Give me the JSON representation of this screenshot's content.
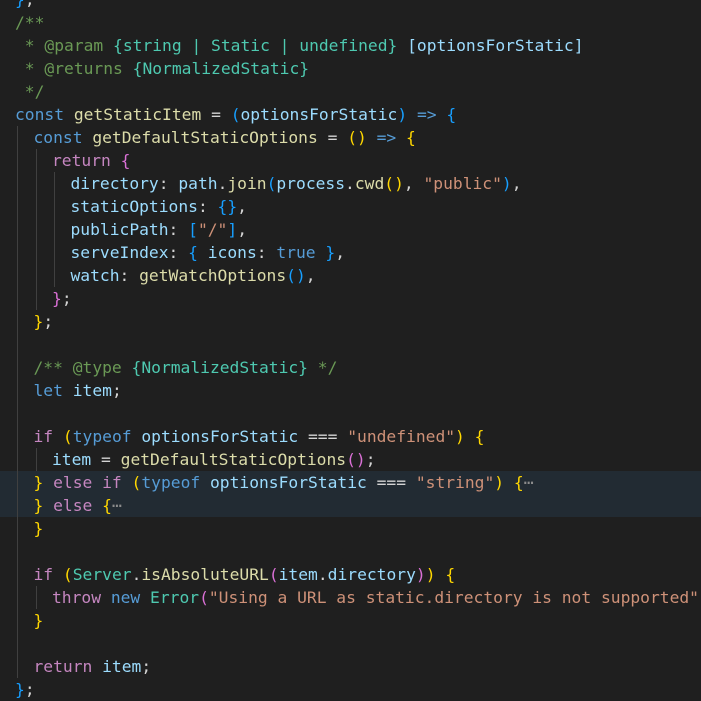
{
  "colors": {
    "background": "#1f1f1f",
    "current_line": "#222b33",
    "indent_guide": "#404040"
  },
  "editor": {
    "language": "javascript",
    "lines": [
      {
        "indent": 1,
        "guides": [],
        "tokens": [
          [
            "b3",
            "}"
          ],
          [
            "pu",
            ";"
          ]
        ]
      },
      {
        "indent": 1,
        "guides": [],
        "tokens": [
          [
            "cm",
            "/**"
          ]
        ]
      },
      {
        "indent": 1,
        "guides": [],
        "tokens": [
          [
            "cm",
            " * @param "
          ],
          [
            "cls",
            "{string | Static | undefined}"
          ],
          [
            "var",
            " [optionsForStatic]"
          ]
        ]
      },
      {
        "indent": 1,
        "guides": [],
        "tokens": [
          [
            "cm",
            " * @returns "
          ],
          [
            "cls",
            "{NormalizedStatic}"
          ]
        ]
      },
      {
        "indent": 1,
        "guides": [],
        "tokens": [
          [
            "cm",
            " */"
          ]
        ]
      },
      {
        "indent": 1,
        "guides": [],
        "tokens": [
          [
            "kw",
            "const "
          ],
          [
            "fn",
            "getStaticItem"
          ],
          [
            "pu",
            " = "
          ],
          [
            "b3",
            "("
          ],
          [
            "var",
            "optionsForStatic"
          ],
          [
            "b3",
            ")"
          ],
          [
            "kw",
            " => "
          ],
          [
            "b3",
            "{"
          ]
        ]
      },
      {
        "indent": 2,
        "guides": [
          1
        ],
        "tokens": [
          [
            "kw",
            "const "
          ],
          [
            "fn",
            "getDefaultStaticOptions"
          ],
          [
            "pu",
            " = "
          ],
          [
            "b1",
            "()"
          ],
          [
            "kw",
            " => "
          ],
          [
            "b1",
            "{"
          ]
        ]
      },
      {
        "indent": 3,
        "guides": [
          1,
          2
        ],
        "tokens": [
          [
            "ctl",
            "return "
          ],
          [
            "b2",
            "{"
          ]
        ]
      },
      {
        "indent": 4,
        "guides": [
          1,
          2,
          3
        ],
        "tokens": [
          [
            "var",
            "directory"
          ],
          [
            "pu",
            ": "
          ],
          [
            "var",
            "path"
          ],
          [
            "pu",
            "."
          ],
          [
            "fn",
            "join"
          ],
          [
            "b3",
            "("
          ],
          [
            "var",
            "process"
          ],
          [
            "pu",
            "."
          ],
          [
            "fn",
            "cwd"
          ],
          [
            "b1",
            "()"
          ],
          [
            "pu",
            ", "
          ],
          [
            "str",
            "\"public\""
          ],
          [
            "b3",
            ")"
          ],
          [
            "pu",
            ","
          ]
        ]
      },
      {
        "indent": 4,
        "guides": [
          1,
          2,
          3
        ],
        "tokens": [
          [
            "var",
            "staticOptions"
          ],
          [
            "pu",
            ": "
          ],
          [
            "b3",
            "{}"
          ],
          [
            "pu",
            ","
          ]
        ]
      },
      {
        "indent": 4,
        "guides": [
          1,
          2,
          3
        ],
        "tokens": [
          [
            "var",
            "publicPath"
          ],
          [
            "pu",
            ": "
          ],
          [
            "b3",
            "["
          ],
          [
            "str",
            "\"/\""
          ],
          [
            "b3",
            "]"
          ],
          [
            "pu",
            ","
          ]
        ]
      },
      {
        "indent": 4,
        "guides": [
          1,
          2,
          3
        ],
        "tokens": [
          [
            "var",
            "serveIndex"
          ],
          [
            "pu",
            ": "
          ],
          [
            "b3",
            "{"
          ],
          [
            "var",
            " icons"
          ],
          [
            "pu",
            ": "
          ],
          [
            "kw",
            "true"
          ],
          [
            "b3",
            " }"
          ],
          [
            "pu",
            ","
          ]
        ]
      },
      {
        "indent": 4,
        "guides": [
          1,
          2,
          3
        ],
        "tokens": [
          [
            "var",
            "watch"
          ],
          [
            "pu",
            ": "
          ],
          [
            "fn",
            "getWatchOptions"
          ],
          [
            "b3",
            "()"
          ],
          [
            "pu",
            ","
          ]
        ]
      },
      {
        "indent": 3,
        "guides": [
          1,
          2
        ],
        "tokens": [
          [
            "b2",
            "}"
          ],
          [
            "pu",
            ";"
          ]
        ]
      },
      {
        "indent": 2,
        "guides": [
          1
        ],
        "tokens": [
          [
            "b1",
            "}"
          ],
          [
            "pu",
            ";"
          ]
        ]
      },
      {
        "indent": 0,
        "guides": [
          1
        ],
        "tokens": []
      },
      {
        "indent": 2,
        "guides": [
          1
        ],
        "tokens": [
          [
            "cm",
            "/** @type "
          ],
          [
            "cls",
            "{NormalizedStatic}"
          ],
          [
            "cm",
            " */"
          ]
        ]
      },
      {
        "indent": 2,
        "guides": [
          1
        ],
        "tokens": [
          [
            "kw",
            "let "
          ],
          [
            "var",
            "item"
          ],
          [
            "pu",
            ";"
          ]
        ]
      },
      {
        "indent": 0,
        "guides": [
          1
        ],
        "tokens": []
      },
      {
        "indent": 2,
        "guides": [
          1
        ],
        "tokens": [
          [
            "ctl",
            "if "
          ],
          [
            "b1",
            "("
          ],
          [
            "kw",
            "typeof "
          ],
          [
            "var",
            "optionsForStatic"
          ],
          [
            "pu",
            " === "
          ],
          [
            "str",
            "\"undefined\""
          ],
          [
            "b1",
            ")"
          ],
          [
            "pu",
            " "
          ],
          [
            "b1",
            "{"
          ]
        ]
      },
      {
        "indent": 3,
        "guides": [
          1,
          2
        ],
        "tokens": [
          [
            "var",
            "item"
          ],
          [
            "pu",
            " = "
          ],
          [
            "fn",
            "getDefaultStaticOptions"
          ],
          [
            "b2",
            "()"
          ],
          [
            "pu",
            ";"
          ]
        ]
      },
      {
        "indent": 2,
        "guides": [
          1
        ],
        "current": true,
        "tokens": [
          [
            "b1",
            "}"
          ],
          [
            "ctl",
            " else if "
          ],
          [
            "b1",
            "("
          ],
          [
            "kw",
            "typeof "
          ],
          [
            "var",
            "optionsForStatic"
          ],
          [
            "pu",
            " === "
          ],
          [
            "str",
            "\"string\""
          ],
          [
            "b1",
            ")"
          ],
          [
            "pu",
            " "
          ],
          [
            "b1",
            "{"
          ],
          [
            "fold",
            "⋯"
          ]
        ]
      },
      {
        "indent": 2,
        "guides": [
          1
        ],
        "current": true,
        "tokens": [
          [
            "b1",
            "}"
          ],
          [
            "ctl",
            " else "
          ],
          [
            "b1",
            "{"
          ],
          [
            "fold",
            "⋯"
          ]
        ]
      },
      {
        "indent": 2,
        "guides": [
          1
        ],
        "tokens": [
          [
            "b1",
            "}"
          ]
        ]
      },
      {
        "indent": 0,
        "guides": [
          1
        ],
        "tokens": []
      },
      {
        "indent": 2,
        "guides": [
          1
        ],
        "tokens": [
          [
            "ctl",
            "if "
          ],
          [
            "b1",
            "("
          ],
          [
            "cls",
            "Server"
          ],
          [
            "pu",
            "."
          ],
          [
            "fn",
            "isAbsoluteURL"
          ],
          [
            "b2",
            "("
          ],
          [
            "var",
            "item"
          ],
          [
            "pu",
            "."
          ],
          [
            "var",
            "directory"
          ],
          [
            "b2",
            ")"
          ],
          [
            "b1",
            ")"
          ],
          [
            "pu",
            " "
          ],
          [
            "b1",
            "{"
          ]
        ]
      },
      {
        "indent": 3,
        "guides": [
          1,
          2
        ],
        "tokens": [
          [
            "ctl",
            "throw "
          ],
          [
            "kw",
            "new "
          ],
          [
            "cls",
            "Error"
          ],
          [
            "b2",
            "("
          ],
          [
            "str",
            "\"Using a URL as static.directory is not supported\""
          ],
          [
            "b2",
            ")"
          ],
          [
            "pu",
            ";"
          ]
        ]
      },
      {
        "indent": 2,
        "guides": [
          1
        ],
        "tokens": [
          [
            "b1",
            "}"
          ]
        ]
      },
      {
        "indent": 0,
        "guides": [
          1
        ],
        "tokens": []
      },
      {
        "indent": 2,
        "guides": [
          1
        ],
        "tokens": [
          [
            "ctl",
            "return "
          ],
          [
            "var",
            "item"
          ],
          [
            "pu",
            ";"
          ]
        ]
      },
      {
        "indent": 1,
        "guides": [],
        "tokens": [
          [
            "b3",
            "}"
          ],
          [
            "pu",
            ";"
          ]
        ]
      }
    ]
  }
}
